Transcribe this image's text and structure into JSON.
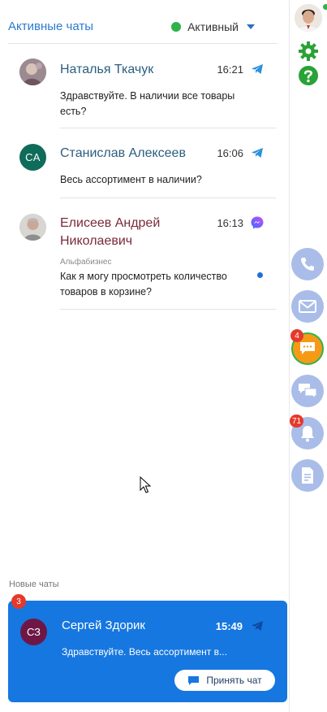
{
  "header": {
    "title": "Активные чаты",
    "status_label": "Активный",
    "status_color": "#2fb24a"
  },
  "chats": [
    {
      "name": "Наталья Ткачук",
      "time": "16:21",
      "channel": "telegram-icon",
      "text_line1": "Здравствуйте. В наличии все товары",
      "text_line2": "есть?"
    },
    {
      "name": "Станислав Алексеев",
      "initials": "СА",
      "time": "16:06",
      "channel": "telegram-icon",
      "text_line1": "Весь ассортимент в наличии?"
    },
    {
      "name_line1": "Елисеев Андрей",
      "name_line2": "Николаевич",
      "time": "16:13",
      "channel": "messenger-icon",
      "source": "Альфабизнес",
      "text_line1": "Как я могу просмотреть количество",
      "text_line2": "товаров в корзине?"
    }
  ],
  "new_chats": {
    "label": "Новые чаты",
    "badge": "3",
    "name": "Сергей Здорик",
    "initials": "СЗ",
    "time": "15:49",
    "channel": "telegram-icon",
    "text": "Здравствуйте. Весь ассортимент в...",
    "accept_label": "Принять чат"
  },
  "sidebar": {
    "icons": [
      "gear-icon",
      "help-icon",
      "phone-icon",
      "mail-icon",
      "chat-icon",
      "chats-icon",
      "bell-icon",
      "document-icon"
    ],
    "chat_badge": "4",
    "bell_badge": "71"
  },
  "colors": {
    "accent": "#2b7bd1",
    "card": "#1677e0",
    "badge": "#e5392c",
    "sidebar_button": "#a9bde8",
    "active_button": "#f59a17"
  }
}
